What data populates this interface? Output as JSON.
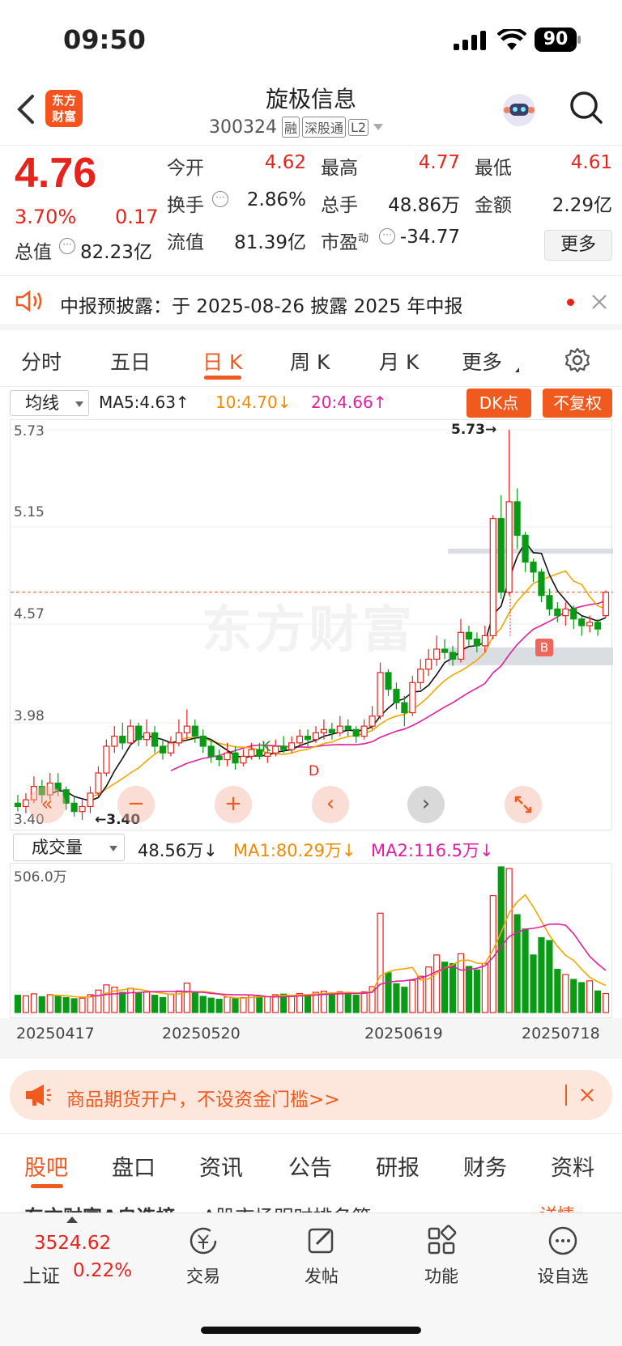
{
  "status_bar": {
    "time": "09:50",
    "battery": "90"
  },
  "header": {
    "logo_line1": "东方",
    "logo_line2": "财富",
    "stock_name": "旋极信息",
    "stock_code": "300324",
    "tags": [
      "融",
      "深股通",
      "L2"
    ]
  },
  "quote": {
    "price": "4.76",
    "change_pct": "3.70%",
    "change_abs": "0.17",
    "fields": [
      {
        "label": "今开",
        "value": "4.62",
        "color": "#e8231b"
      },
      {
        "label": "最高",
        "value": "4.77",
        "color": "#e8231b"
      },
      {
        "label": "最低",
        "value": "4.61",
        "color": "#e8231b"
      },
      {
        "label": "换手",
        "value": "2.86%",
        "color": "#222222"
      },
      {
        "label": "总手",
        "value": "48.86万",
        "color": "#222222"
      },
      {
        "label": "金额",
        "value": "2.29亿",
        "color": "#222222"
      },
      {
        "label": "总值",
        "value": "82.23亿",
        "color": "#222222"
      },
      {
        "label": "流值",
        "value": "81.39亿",
        "color": "#222222"
      },
      {
        "label": "市盈",
        "label_sup": "动",
        "value": "-34.77",
        "color": "#222222"
      }
    ],
    "more_label": "更多"
  },
  "notice": {
    "text": "中报预披露：于 2025-08-26 披露 2025 年中报"
  },
  "chart_tabs": {
    "items": [
      "分时",
      "五日",
      "日 K",
      "周 K",
      "月 K",
      "更多"
    ],
    "active": "日 K"
  },
  "kline_legend": {
    "selector": "均线",
    "ma5": "MA5:4.63↑",
    "ma10": "10:4.70↓",
    "ma20": "20:4.66↑",
    "dk_button": "DK点",
    "fq_button": "不复权"
  },
  "kline_axis": {
    "y_labels": [
      "5.73",
      "5.15",
      "4.57",
      "3.98",
      "3.40"
    ],
    "max_label": "5.73→",
    "min_label": "←3.40"
  },
  "kline_marks": {
    "k": "K",
    "d": "D",
    "b": "B"
  },
  "watermark": "东方财富",
  "volume_legend": {
    "selector": "成交量",
    "value": "48.56万↓",
    "ma1": "MA1:80.29万↓",
    "ma2": "MA2:116.5万↓",
    "max_label": "506.0万"
  },
  "dates": [
    "20250417",
    "20250520",
    "20250619",
    "20250718"
  ],
  "chart_data": {
    "type": "candlestick",
    "ylim": [
      3.4,
      5.73
    ],
    "current_price": 4.76,
    "candles": [
      [
        3.5,
        3.48,
        3.55,
        3.45
      ],
      [
        3.48,
        3.52,
        3.56,
        3.44
      ],
      [
        3.52,
        3.6,
        3.66,
        3.5
      ],
      [
        3.6,
        3.55,
        3.64,
        3.5
      ],
      [
        3.55,
        3.62,
        3.68,
        3.52
      ],
      [
        3.62,
        3.58,
        3.68,
        3.54
      ],
      [
        3.58,
        3.5,
        3.6,
        3.46
      ],
      [
        3.5,
        3.45,
        3.54,
        3.42
      ],
      [
        3.45,
        3.48,
        3.52,
        3.4
      ],
      [
        3.48,
        3.56,
        3.6,
        3.44
      ],
      [
        3.56,
        3.68,
        3.72,
        3.54
      ],
      [
        3.68,
        3.84,
        3.88,
        3.66
      ],
      [
        3.84,
        3.9,
        3.96,
        3.8
      ],
      [
        3.9,
        3.86,
        3.98,
        3.82
      ],
      [
        3.86,
        3.96,
        4.0,
        3.84
      ],
      [
        3.96,
        3.88,
        3.98,
        3.84
      ],
      [
        3.88,
        3.92,
        4.0,
        3.84
      ],
      [
        3.92,
        3.84,
        3.96,
        3.8
      ],
      [
        3.84,
        3.8,
        3.88,
        3.76
      ],
      [
        3.8,
        3.86,
        3.9,
        3.78
      ],
      [
        3.86,
        3.92,
        4.0,
        3.84
      ],
      [
        3.92,
        3.96,
        4.06,
        3.88
      ],
      [
        3.96,
        3.9,
        4.0,
        3.86
      ],
      [
        3.9,
        3.84,
        3.94,
        3.8
      ],
      [
        3.84,
        3.78,
        3.88,
        3.74
      ],
      [
        3.78,
        3.76,
        3.82,
        3.72
      ],
      [
        3.76,
        3.8,
        3.86,
        3.72
      ],
      [
        3.8,
        3.74,
        3.84,
        3.7
      ],
      [
        3.74,
        3.78,
        3.82,
        3.72
      ],
      [
        3.78,
        3.82,
        3.86,
        3.76
      ],
      [
        3.82,
        3.78,
        3.86,
        3.76
      ],
      [
        3.78,
        3.8,
        3.84,
        3.74
      ],
      [
        3.8,
        3.84,
        3.88,
        3.78
      ],
      [
        3.84,
        3.82,
        3.9,
        3.8
      ],
      [
        3.82,
        3.86,
        3.9,
        3.8
      ],
      [
        3.86,
        3.9,
        3.94,
        3.84
      ],
      [
        3.9,
        3.88,
        3.94,
        3.84
      ],
      [
        3.88,
        3.92,
        3.96,
        3.86
      ],
      [
        3.92,
        3.94,
        4.0,
        3.88
      ],
      [
        3.94,
        3.92,
        3.98,
        3.88
      ],
      [
        3.92,
        3.96,
        4.02,
        3.9
      ],
      [
        3.96,
        3.94,
        4.0,
        3.9
      ],
      [
        3.94,
        3.9,
        3.96,
        3.86
      ],
      [
        3.9,
        3.96,
        4.0,
        3.88
      ],
      [
        3.96,
        4.02,
        4.08,
        3.94
      ],
      [
        4.02,
        4.28,
        4.34,
        4.0
      ],
      [
        4.28,
        4.18,
        4.3,
        4.14
      ],
      [
        4.18,
        4.1,
        4.22,
        4.06
      ],
      [
        4.1,
        4.04,
        4.14,
        3.96
      ],
      [
        4.04,
        4.22,
        4.26,
        4.02
      ],
      [
        4.22,
        4.3,
        4.36,
        4.18
      ],
      [
        4.3,
        4.36,
        4.42,
        4.26
      ],
      [
        4.36,
        4.42,
        4.5,
        4.32
      ],
      [
        4.42,
        4.4,
        4.48,
        4.36
      ],
      [
        4.4,
        4.36,
        4.44,
        4.32
      ],
      [
        4.36,
        4.52,
        4.6,
        4.34
      ],
      [
        4.52,
        4.48,
        4.56,
        4.44
      ],
      [
        4.48,
        4.44,
        4.52,
        4.4
      ],
      [
        4.44,
        4.5,
        4.56,
        4.4
      ],
      [
        4.5,
        5.2,
        5.22,
        4.48
      ],
      [
        5.2,
        4.76,
        5.34,
        4.72
      ],
      [
        4.76,
        5.3,
        5.73,
        4.74
      ],
      [
        5.3,
        5.1,
        5.38,
        5.02
      ],
      [
        5.1,
        4.94,
        5.12,
        4.88
      ],
      [
        4.94,
        4.88,
        4.96,
        4.82
      ],
      [
        4.88,
        4.74,
        4.9,
        4.7
      ],
      [
        4.74,
        4.66,
        4.78,
        4.62
      ],
      [
        4.66,
        4.62,
        4.7,
        4.58
      ],
      [
        4.62,
        4.66,
        4.7,
        4.56
      ],
      [
        4.66,
        4.6,
        4.68,
        4.54
      ],
      [
        4.6,
        4.56,
        4.62,
        4.5
      ],
      [
        4.56,
        4.58,
        4.62,
        4.52
      ],
      [
        4.58,
        4.54,
        4.6,
        4.5
      ],
      [
        4.62,
        4.76,
        4.77,
        4.61
      ]
    ],
    "volumes": [
      60,
      58,
      65,
      55,
      62,
      58,
      52,
      48,
      50,
      62,
      78,
      96,
      88,
      70,
      84,
      66,
      72,
      60,
      52,
      64,
      75,
      102,
      68,
      56,
      50,
      46,
      54,
      48,
      52,
      60,
      58,
      56,
      62,
      64,
      58,
      66,
      62,
      70,
      74,
      68,
      72,
      68,
      60,
      72,
      90,
      345,
      138,
      100,
      88,
      112,
      126,
      158,
      200,
      175,
      170,
      204,
      160,
      148,
      170,
      406,
      506,
      500,
      340,
      290,
      200,
      260,
      250,
      150,
      132,
      115,
      104,
      110,
      75,
      66
    ],
    "ma5_vol_note": "MA1 and MA2 are drawn from volumes"
  },
  "ad_banner": {
    "text": "商品期货开户，不设资金门槛>>"
  },
  "sub_tabs": {
    "items": [
      "股吧",
      "盘口",
      "资讯",
      "公告",
      "研报",
      "财务",
      "资料"
    ],
    "active": "股吧"
  },
  "peek_text": {
    "left": "东方财富A自选榜",
    "mid": "A股市场明时排名第",
    "right": "详情»"
  },
  "bottom_nav": {
    "index_value": "3524.62",
    "index_name": "上证",
    "index_change": "0.22%",
    "items": [
      "交易",
      "发帖",
      "功能",
      "设自选"
    ]
  }
}
